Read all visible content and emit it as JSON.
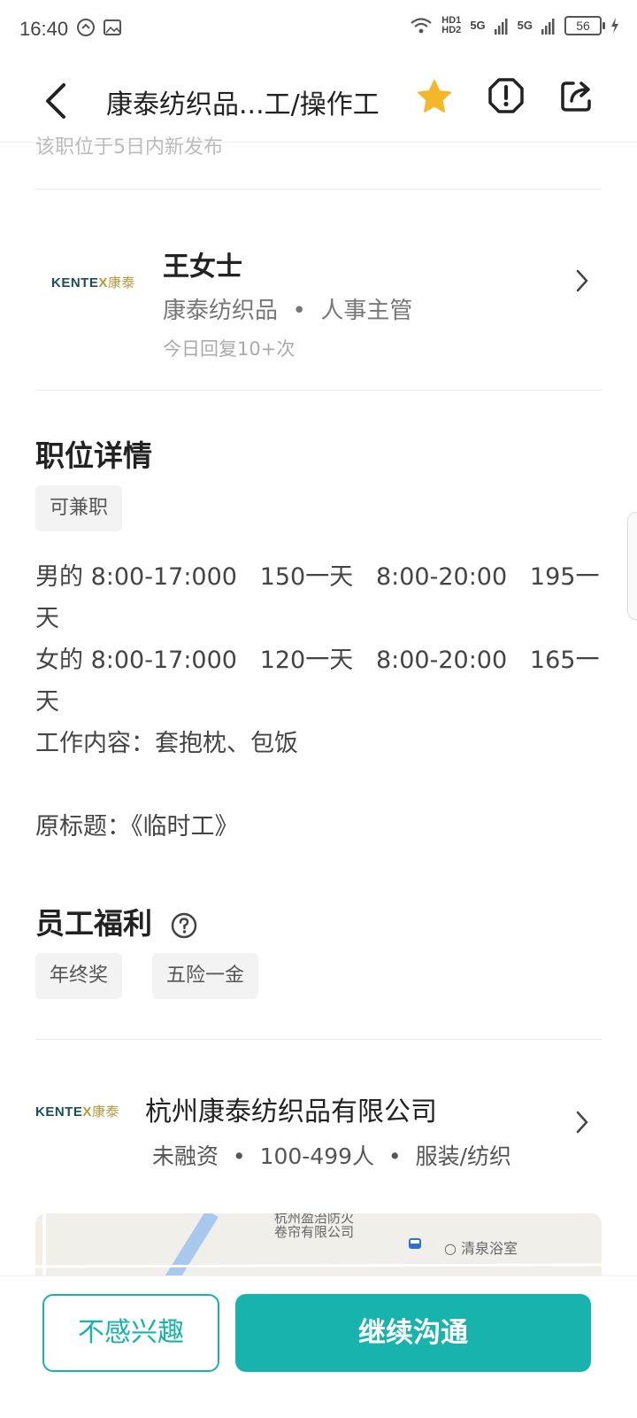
{
  "status_bar": {
    "time": "16:40",
    "network1": "HD1\nHD2",
    "signal1": "5G",
    "signal2": "5G",
    "battery": "56"
  },
  "header": {
    "title": "康泰纺织品...工/操作工"
  },
  "top_partial_text": "该职位于5日内新发布",
  "recruiter": {
    "logo_en": "KENTE",
    "logo_x": "X",
    "logo_cn": "康泰",
    "name": "王女士",
    "company": "康泰纺织品",
    "role": "人事主管",
    "reply": "今日回复10+次"
  },
  "job_details": {
    "title": "职位详情",
    "tag": "可兼职",
    "lines": [
      "男的 8:00-17:000   150一天   8:00-20:00   195一",
      "天",
      "女的 8:00-17:000   120一天   8:00-20:00   165一",
      "天",
      "工作内容：套抱枕、包饭",
      "",
      "原标题：《临时工》"
    ]
  },
  "benefits": {
    "title": "员工福利",
    "tags": [
      "年终奖",
      "五险一金"
    ]
  },
  "company": {
    "name": "杭州康泰纺织品有限公司",
    "funding": "未融资",
    "size": "100-499人",
    "industry": "服装/纺织"
  },
  "map": {
    "label1": "杭州盈治防火",
    "label2": "卷帘有限公司",
    "label3": "清泉浴室"
  },
  "actions": {
    "not_interested": "不感兴趣",
    "continue_chat": "继续沟通"
  },
  "colors": {
    "accent": "#19b3ad",
    "star": "#f5b72a"
  }
}
